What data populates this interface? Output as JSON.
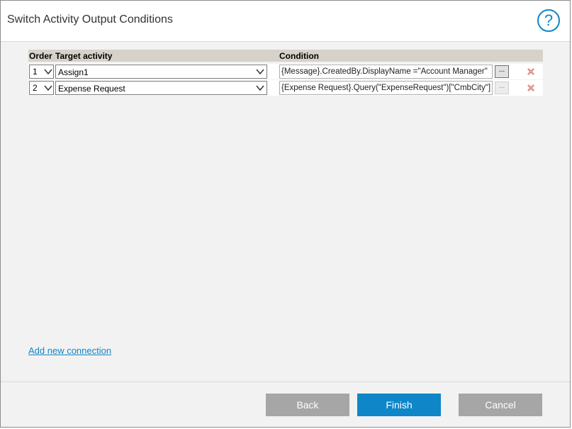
{
  "dialog": {
    "title": "Switch Activity Output Conditions",
    "help_icon": "?"
  },
  "grid": {
    "columns": {
      "order": "Order",
      "target": "Target activity",
      "condition": "Condition"
    },
    "rows": [
      {
        "order": "1",
        "target": "Assign1",
        "condition": "{Message}.CreatedBy.DisplayName =\"Account Manager\"",
        "ellipsis": "..."
      },
      {
        "order": "2",
        "target": "Expense Request",
        "condition": "{Expense Request}.Query(\"ExpenseRequest\")[\"CmbCity\"]",
        "ellipsis": "..."
      }
    ]
  },
  "links": {
    "add_connection": "Add new connection"
  },
  "buttons": {
    "back": "Back",
    "finish": "Finish",
    "cancel": "Cancel"
  },
  "colors": {
    "accent": "#0e86c8",
    "header_bg": "#d6d2ca",
    "disabled_button": "#a6a6a6",
    "delete_icon": "#c0392b"
  },
  "icons": {
    "help": "question-circle-icon",
    "dropdown": "chevron-down-icon",
    "delete": "delete-x-icon"
  }
}
